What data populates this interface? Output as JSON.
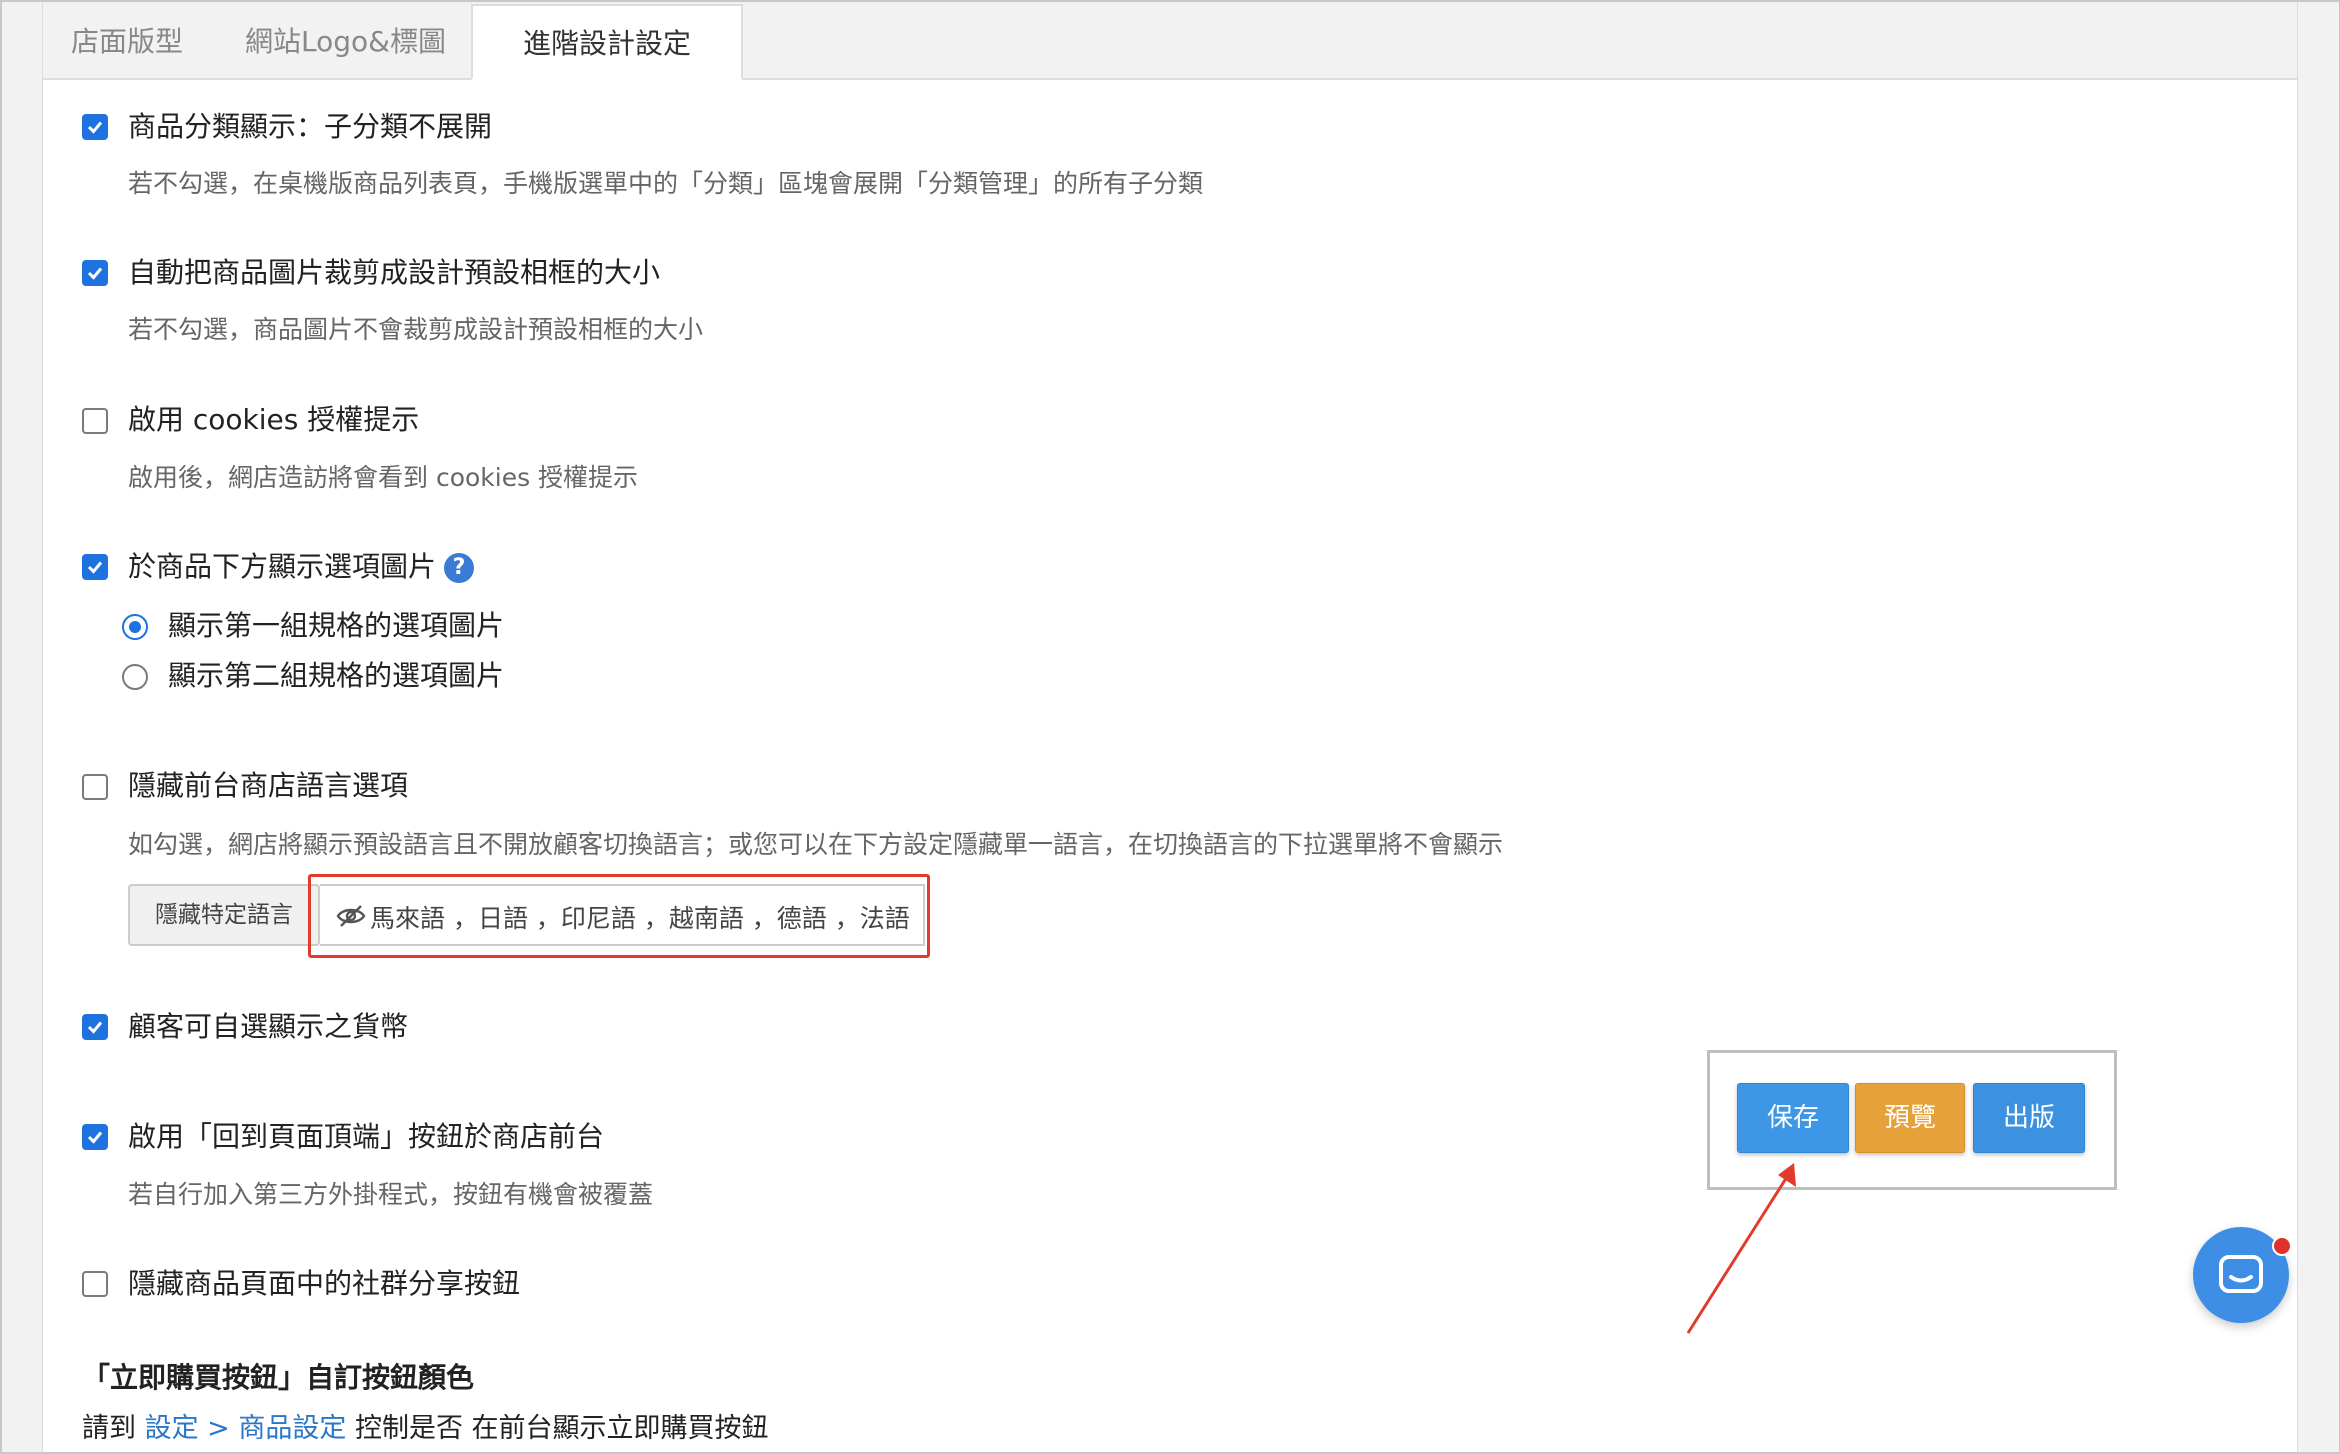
{
  "tabs": [
    {
      "label": "店面版型",
      "active": false
    },
    {
      "label": "網站Logo&標圖",
      "active": false
    },
    {
      "label": "進階設計設定",
      "active": true
    }
  ],
  "settings": [
    {
      "label": "商品分類顯示：子分類不展開",
      "checked": true,
      "desc": "若不勾選，在桌機版商品列表頁，手機版選單中的「分類」區塊會展開「分類管理」的所有子分類"
    },
    {
      "label": "自動把商品圖片裁剪成設計預設相框的大小",
      "checked": true,
      "desc": "若不勾選，商品圖片不會裁剪成設計預設相框的大小"
    },
    {
      "label": "啟用 cookies 授權提示",
      "checked": false,
      "desc": "啟用後，網店造訪將會看到 cookies 授權提示"
    },
    {
      "label": "於商品下方顯示選項圖片",
      "checked": true,
      "help_icon": "question-circle-icon"
    },
    {
      "label": "隱藏前台商店語言選項",
      "checked": false,
      "desc": "如勾選，網店將顯示預設語言且不開放顧客切換語言；或您可以在下方設定隱藏單一語言，在切換語言的下拉選單將不會顯示"
    },
    {
      "label": "顧客可自選顯示之貨幣",
      "checked": true
    },
    {
      "label": "啟用「回到頁面頂端」按鈕於商店前台",
      "checked": true,
      "desc": "若自行加入第三方外掛程式，按鈕有機會被覆蓋"
    },
    {
      "label": "隱藏商品頁面中的社群分享按鈕",
      "checked": false
    }
  ],
  "option_image_radios": [
    {
      "label": "顯示第一組規格的選項圖片",
      "selected": true
    },
    {
      "label": "顯示第二組規格的選項圖片",
      "selected": false
    }
  ],
  "hide_language": {
    "button_label": "隱藏特定語言",
    "eye_icon": "eye-slash-icon",
    "hidden_languages_text": "馬來語 ，日語 ，印尼語 ，越南語 ，德語 ，法語"
  },
  "actions": {
    "save": "保存",
    "preview": "預覽",
    "publish": "出版"
  },
  "buy_now_section": {
    "title": "「立即購買按鈕」自訂按鈕顏色",
    "text_before": "請到 ",
    "link": "設定 > 商品設定",
    "text_after": " 控制是否 在前台顯示立即購買按鈕"
  },
  "colors": {
    "checkbox_checked": "#1e72e0",
    "annotation_red": "#e23b2e",
    "save_button": "#3d97e6",
    "preview_button": "#e7a13a",
    "publish_button": "#3c92e0",
    "chat_button": "#3e8ee6"
  },
  "chat": {
    "icon": "chat-icon",
    "notification_dot": true
  }
}
